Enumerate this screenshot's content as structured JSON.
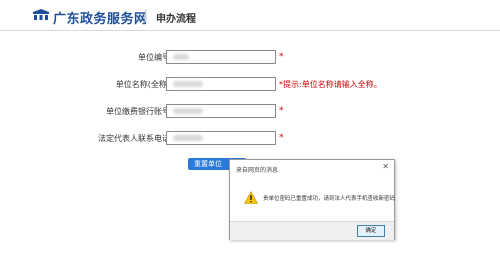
{
  "header": {
    "site_name": "广东政务服务网",
    "page_title": "申办流程",
    "brand_color": "#1f4f9c"
  },
  "form": {
    "fields": [
      {
        "label": "单位编号",
        "marker": "*",
        "hint": ""
      },
      {
        "label": "单位名称(全称)",
        "marker": "",
        "hint": "*提示:单位名称请输入全称。"
      },
      {
        "label": "单位缴费银行账号",
        "marker": "*",
        "hint": ""
      },
      {
        "label": "法定代表人联系电话",
        "marker": "*",
        "hint": ""
      }
    ],
    "reset_button": "重置单位"
  },
  "dialog": {
    "title": "来自网页的消息",
    "close": "✕",
    "message": "贵单位密码已重置成功，请到法人代表手机查收新密码",
    "ok": "确定",
    "icon": "warning-icon"
  }
}
